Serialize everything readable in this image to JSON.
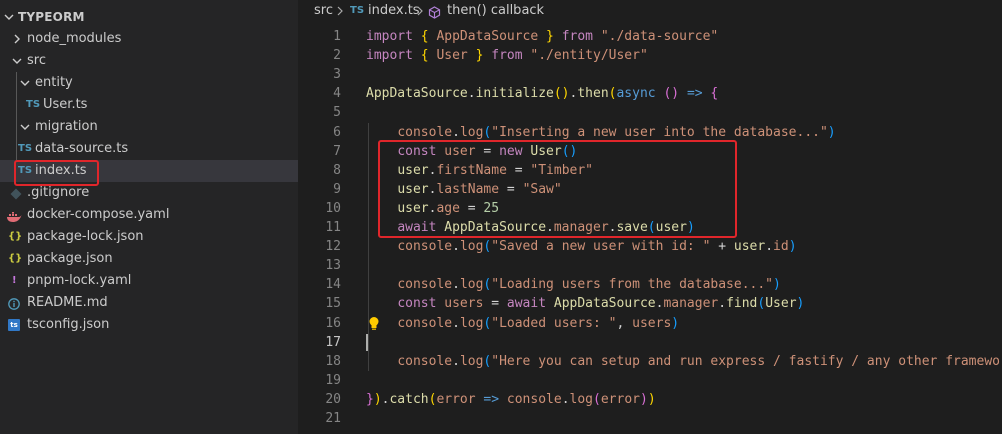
{
  "explorer": {
    "title": "TYPEORM",
    "items": [
      {
        "label": "node_modules",
        "icon": "chevron-right"
      },
      {
        "label": "src",
        "icon": "chevron-down"
      },
      {
        "label": "entity",
        "icon": "chevron-down"
      },
      {
        "label": "User.ts",
        "icon": "ts-file",
        "badge": "TS"
      },
      {
        "label": "migration",
        "icon": "chevron-down"
      },
      {
        "label": "data-source.ts",
        "icon": "ts-file",
        "badge": "TS"
      },
      {
        "label": "index.ts",
        "icon": "ts-file",
        "badge": "TS",
        "selected": true
      },
      {
        "label": ".gitignore",
        "icon": "git-icon"
      },
      {
        "label": "docker-compose.yaml",
        "icon": "docker-icon"
      },
      {
        "label": "package-lock.json",
        "icon": "json-icon",
        "badge": "{}"
      },
      {
        "label": "package.json",
        "icon": "json-icon",
        "badge": "{}"
      },
      {
        "label": "pnpm-lock.yaml",
        "icon": "pnpm-icon",
        "badge": "!"
      },
      {
        "label": "README.md",
        "icon": "info-icon"
      },
      {
        "label": "tsconfig.json",
        "icon": "tsconfig-icon",
        "badge": "ts"
      }
    ]
  },
  "breadcrumb": {
    "folder": "src",
    "file_badge": "TS",
    "file": "index.ts",
    "symbol": "then() callback"
  },
  "editor": {
    "active_line": 17,
    "lightbulb_line": 16,
    "lines": [
      {
        "n": "1",
        "t": [
          [
            "kw",
            "import"
          ],
          [
            "plain",
            " "
          ],
          [
            "br1",
            "{"
          ],
          [
            "plain",
            " "
          ],
          [
            "str",
            "AppDataSource"
          ],
          [
            "plain",
            " "
          ],
          [
            "br1",
            "}"
          ],
          [
            "plain",
            " "
          ],
          [
            "kw",
            "from"
          ],
          [
            "plain",
            " "
          ],
          [
            "str",
            "\"./data-source\""
          ]
        ]
      },
      {
        "n": "2",
        "t": [
          [
            "kw",
            "import"
          ],
          [
            "plain",
            " "
          ],
          [
            "br1",
            "{"
          ],
          [
            "plain",
            " "
          ],
          [
            "str",
            "User"
          ],
          [
            "plain",
            " "
          ],
          [
            "br1",
            "}"
          ],
          [
            "plain",
            " "
          ],
          [
            "kw",
            "from"
          ],
          [
            "plain",
            " "
          ],
          [
            "str",
            "\"./entity/User\""
          ]
        ]
      },
      {
        "n": "3",
        "t": []
      },
      {
        "n": "4",
        "t": [
          [
            "fn",
            "AppDataSource"
          ],
          [
            "plain",
            "."
          ],
          [
            "fn",
            "initialize"
          ],
          [
            "br1",
            "()"
          ],
          [
            "plain",
            "."
          ],
          [
            "fn",
            "then"
          ],
          [
            "br1",
            "("
          ],
          [
            "kw2",
            "async"
          ],
          [
            "plain",
            " "
          ],
          [
            "br2",
            "()"
          ],
          [
            "plain",
            " "
          ],
          [
            "kw2",
            "=>"
          ],
          [
            "plain",
            " "
          ],
          [
            "br2",
            "{"
          ]
        ]
      },
      {
        "n": "5",
        "t": []
      },
      {
        "n": "6",
        "t": [
          [
            "plain",
            "    "
          ],
          [
            "str",
            "console"
          ],
          [
            "plain",
            "."
          ],
          [
            "str",
            "log"
          ],
          [
            "br3",
            "("
          ],
          [
            "str",
            "\"Inserting a new user into the database...\""
          ],
          [
            "br3",
            ")"
          ]
        ]
      },
      {
        "n": "7",
        "t": [
          [
            "plain",
            "    "
          ],
          [
            "kw",
            "const"
          ],
          [
            "plain",
            " "
          ],
          [
            "str",
            "user"
          ],
          [
            "plain",
            " = "
          ],
          [
            "kw",
            "new"
          ],
          [
            "plain",
            " "
          ],
          [
            "fn",
            "User"
          ],
          [
            "br3",
            "()"
          ]
        ]
      },
      {
        "n": "8",
        "t": [
          [
            "plain",
            "    "
          ],
          [
            "fn",
            "user"
          ],
          [
            "plain",
            "."
          ],
          [
            "str",
            "firstName"
          ],
          [
            "plain",
            " = "
          ],
          [
            "str",
            "\"Timber\""
          ]
        ]
      },
      {
        "n": "9",
        "t": [
          [
            "plain",
            "    "
          ],
          [
            "fn",
            "user"
          ],
          [
            "plain",
            "."
          ],
          [
            "str",
            "lastName"
          ],
          [
            "plain",
            " = "
          ],
          [
            "str",
            "\"Saw\""
          ]
        ]
      },
      {
        "n": "10",
        "t": [
          [
            "plain",
            "    "
          ],
          [
            "fn",
            "user"
          ],
          [
            "plain",
            "."
          ],
          [
            "str",
            "age"
          ],
          [
            "plain",
            " = "
          ],
          [
            "num",
            "25"
          ]
        ]
      },
      {
        "n": "11",
        "t": [
          [
            "plain",
            "    "
          ],
          [
            "kw",
            "await"
          ],
          [
            "plain",
            " "
          ],
          [
            "fn",
            "AppDataSource"
          ],
          [
            "plain",
            "."
          ],
          [
            "str",
            "manager"
          ],
          [
            "plain",
            "."
          ],
          [
            "fn",
            "save"
          ],
          [
            "br3",
            "("
          ],
          [
            "fn",
            "user"
          ],
          [
            "br3",
            ")"
          ]
        ]
      },
      {
        "n": "12",
        "t": [
          [
            "plain",
            "    "
          ],
          [
            "str",
            "console"
          ],
          [
            "plain",
            "."
          ],
          [
            "str",
            "log"
          ],
          [
            "br3",
            "("
          ],
          [
            "str",
            "\"Saved a new user with id: \""
          ],
          [
            "plain",
            " + "
          ],
          [
            "fn",
            "user"
          ],
          [
            "plain",
            "."
          ],
          [
            "str",
            "id"
          ],
          [
            "br3",
            ")"
          ]
        ]
      },
      {
        "n": "13",
        "t": []
      },
      {
        "n": "14",
        "t": [
          [
            "plain",
            "    "
          ],
          [
            "str",
            "console"
          ],
          [
            "plain",
            "."
          ],
          [
            "str",
            "log"
          ],
          [
            "br3",
            "("
          ],
          [
            "str",
            "\"Loading users from the database...\""
          ],
          [
            "br3",
            ")"
          ]
        ]
      },
      {
        "n": "15",
        "t": [
          [
            "plain",
            "    "
          ],
          [
            "kw",
            "const"
          ],
          [
            "plain",
            " "
          ],
          [
            "str",
            "users"
          ],
          [
            "plain",
            " = "
          ],
          [
            "kw",
            "await"
          ],
          [
            "plain",
            " "
          ],
          [
            "fn",
            "AppDataSource"
          ],
          [
            "plain",
            "."
          ],
          [
            "str",
            "manager"
          ],
          [
            "plain",
            "."
          ],
          [
            "fn",
            "find"
          ],
          [
            "br3",
            "("
          ],
          [
            "fn",
            "User"
          ],
          [
            "br3",
            ")"
          ]
        ]
      },
      {
        "n": "16",
        "t": [
          [
            "plain",
            "    "
          ],
          [
            "str",
            "console"
          ],
          [
            "plain",
            "."
          ],
          [
            "str",
            "log"
          ],
          [
            "br3",
            "("
          ],
          [
            "str",
            "\"Loaded users: \""
          ],
          [
            "plain",
            ", "
          ],
          [
            "str",
            "users"
          ],
          [
            "br3",
            ")"
          ]
        ]
      },
      {
        "n": "17",
        "t": []
      },
      {
        "n": "18",
        "t": [
          [
            "plain",
            "    "
          ],
          [
            "str",
            "console"
          ],
          [
            "plain",
            "."
          ],
          [
            "str",
            "log"
          ],
          [
            "br3",
            "("
          ],
          [
            "str",
            "\"Here you can setup and run express / fastify / any other framework.\""
          ],
          [
            "br3",
            ")"
          ]
        ]
      },
      {
        "n": "19",
        "t": []
      },
      {
        "n": "20",
        "t": [
          [
            "br2",
            "}"
          ],
          [
            "br1",
            ")"
          ],
          [
            "plain",
            "."
          ],
          [
            "fn",
            "catch"
          ],
          [
            "br1",
            "("
          ],
          [
            "str",
            "error"
          ],
          [
            "plain",
            " "
          ],
          [
            "kw2",
            "=>"
          ],
          [
            "plain",
            " "
          ],
          [
            "str",
            "console"
          ],
          [
            "plain",
            "."
          ],
          [
            "str",
            "log"
          ],
          [
            "br2",
            "("
          ],
          [
            "str",
            "error"
          ],
          [
            "br2",
            ")"
          ],
          [
            "br1",
            ")"
          ]
        ]
      },
      {
        "n": "21",
        "t": []
      }
    ]
  },
  "colors": {
    "highlight_box": "#e0262b",
    "sidebar_bg": "#252526",
    "editor_bg": "#1e1e1e"
  }
}
